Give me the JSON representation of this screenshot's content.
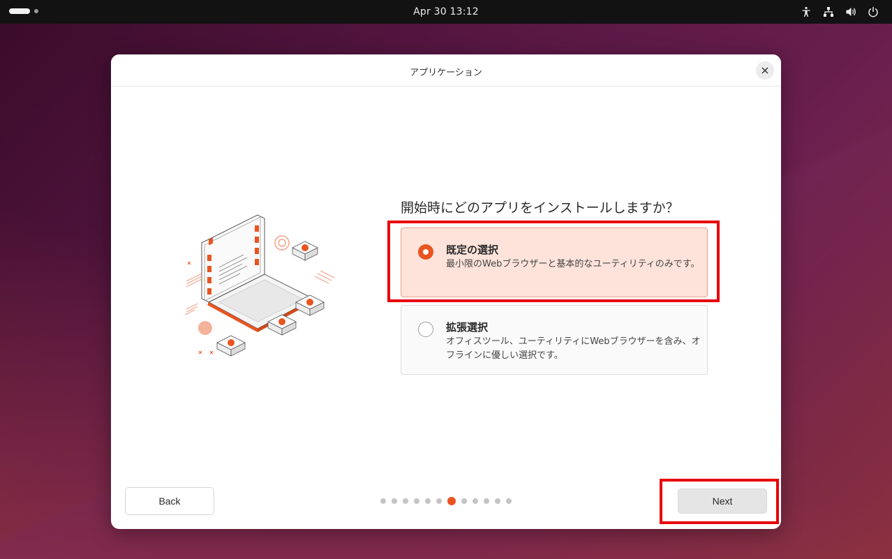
{
  "topbar": {
    "clock": "Apr 30  13:12",
    "icons": [
      "accessibility-icon",
      "network-icon",
      "volume-icon",
      "power-icon"
    ]
  },
  "dialog": {
    "title": "アプリケーション",
    "question": "開始時にどのアプリをインストールしますか？",
    "options": [
      {
        "title": "既定の選択",
        "description": "最小限のWebブラウザーと基本的なユーティリティのみです。",
        "selected": true
      },
      {
        "title": "拡張選択",
        "description": "オフィスツール、ユーティリティにWebブラウザーを含み、オフラインに優しい選択です。",
        "selected": false
      }
    ],
    "back_label": "Back",
    "next_label": "Next",
    "pager": {
      "total": 12,
      "current": 7
    }
  },
  "colors": {
    "accent": "#e95420",
    "selected_bg": "#fde3da",
    "highlight": "#e8000a"
  }
}
